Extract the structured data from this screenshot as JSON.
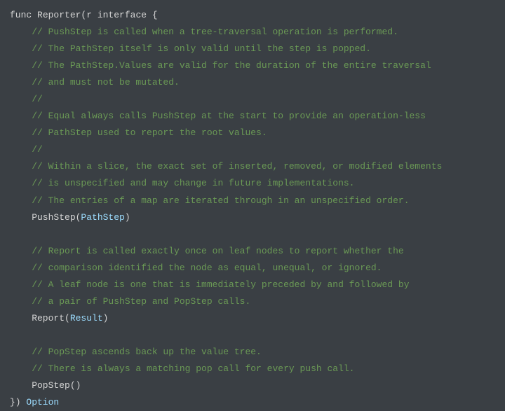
{
  "code": {
    "l0_kw": "func",
    "l0_fn": " Reporter(r ",
    "l0_iface": "interface",
    "l0_brace": " {",
    "c1": "    // PushStep is called when a tree-traversal operation is performed.",
    "c2": "    // The PathStep itself is only valid until the step is popped.",
    "c3": "    // The PathStep.Values are valid for the duration of the entire traversal",
    "c4": "    // and must not be mutated.",
    "c5": "    //",
    "c6": "    // Equal always calls PushStep at the start to provide an operation-less",
    "c7": "    // PathStep used to report the root values.",
    "c8": "    //",
    "c9": "    // Within a slice, the exact set of inserted, removed, or modified elements",
    "c10": "    // is unspecified and may change in future implementations.",
    "c11": "    // The entries of a map are iterated through in an unspecified order.",
    "m1_pre": "    PushStep(",
    "m1_type": "PathStep",
    "m1_post": ")",
    "blank1": "",
    "c12": "    // Report is called exactly once on leaf nodes to report whether the",
    "c13": "    // comparison identified the node as equal, unequal, or ignored.",
    "c14": "    // A leaf node is one that is immediately preceded by and followed by",
    "c15": "    // a pair of PushStep and PopStep calls.",
    "m2_pre": "    Report(",
    "m2_type": "Result",
    "m2_post": ")",
    "blank2": "",
    "c16": "    // PopStep ascends back up the value tree.",
    "c17": "    // There is always a matching pop call for every push call.",
    "m3": "    PopStep()",
    "close": "}) ",
    "ret_type": "Option"
  }
}
